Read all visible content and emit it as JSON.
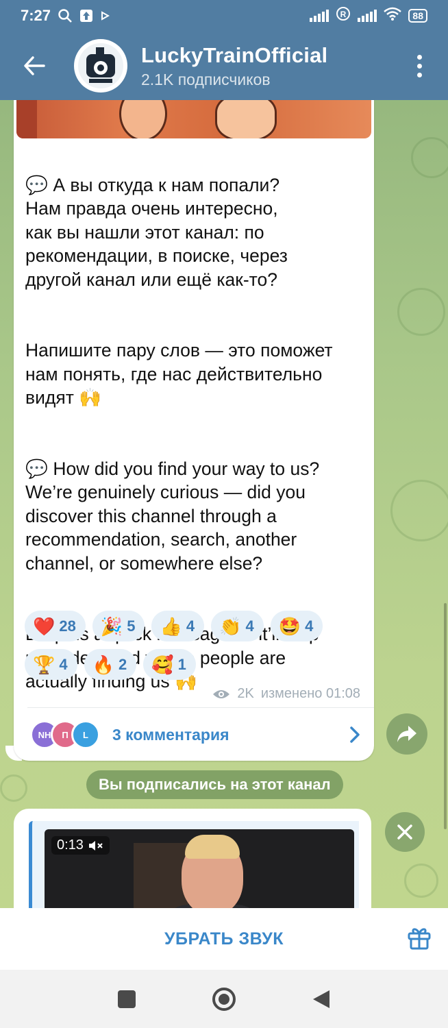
{
  "status_bar": {
    "time": "7:27",
    "battery": "88",
    "icons": [
      "search-icon",
      "app-icon",
      "play-icon",
      "signal-icon",
      "roaming-icon",
      "signal-icon",
      "wifi-icon",
      "battery-icon"
    ]
  },
  "header": {
    "channel_name": "LuckyTrainOfficial",
    "subscribers": "2.1K подписчиков",
    "accent": "#517da2"
  },
  "post": {
    "paragraphs": [
      "💬 А вы откуда к нам попали?\nНам правда очень интересно,\nкак вы нашли этот канал: по\nрекомендации, в поиске, через\nдругой канал или ещё как-то?",
      "Напишите пару слов — это поможет\nнам понять, где нас действительно\nвидят 🙌",
      "💬 How did you find your way to us?\nWe’re genuinely curious — did you\ndiscover this channel through a\nrecommendation, search, another\nchannel, or somewhere else?",
      "Drop us a quick message — it’ll help\nus understand where people are\nactually finding us 🙌"
    ],
    "reactions_row1": [
      {
        "emoji": "❤️",
        "count": "28"
      },
      {
        "emoji": "🎉",
        "count": "5"
      },
      {
        "emoji": "👍",
        "count": "4"
      },
      {
        "emoji": "👏",
        "count": "4"
      },
      {
        "emoji": "🤩",
        "count": "4"
      }
    ],
    "reactions_row2": [
      {
        "emoji": "🏆",
        "count": "4"
      },
      {
        "emoji": "🔥",
        "count": "2"
      },
      {
        "emoji": "🥰",
        "count": "1"
      }
    ],
    "views": "2K",
    "edited": "изменено 01:08",
    "comment_avatars": [
      {
        "initials": "NH",
        "color": "#8a6fd6"
      },
      {
        "initials": "П",
        "color": "#e06a8a"
      },
      {
        "initials": "L",
        "color": "#3aa0e0"
      }
    ],
    "comments_label": "3 комментария"
  },
  "service_message": "Вы подписались на этот канал",
  "video": {
    "time": "0:13"
  },
  "bottom_bar": {
    "mute_label": "УБРАТЬ ЗВУК"
  }
}
